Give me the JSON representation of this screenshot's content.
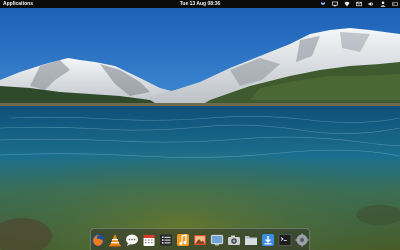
{
  "panel": {
    "applications_label": "Applications",
    "clock": "Tue 13 Aug 08:36"
  },
  "indicators": [
    {
      "icon": "dropbox-icon"
    },
    {
      "icon": "display-icon"
    },
    {
      "icon": "wifi-icon"
    },
    {
      "icon": "mail-icon"
    },
    {
      "icon": "volume-icon"
    },
    {
      "icon": "user-icon"
    },
    {
      "icon": "power-icon"
    }
  ],
  "dock": [
    {
      "icon": "firefox-icon"
    },
    {
      "icon": "vlc-icon"
    },
    {
      "icon": "chat-icon"
    },
    {
      "icon": "calendar-icon"
    },
    {
      "icon": "task-list-icon"
    },
    {
      "icon": "music-icon"
    },
    {
      "icon": "photos-icon"
    },
    {
      "icon": "screenshot-icon"
    },
    {
      "icon": "camera-icon"
    },
    {
      "icon": "files-icon"
    },
    {
      "icon": "downloads-icon"
    },
    {
      "icon": "terminal-icon"
    },
    {
      "icon": "settings-icon"
    }
  ],
  "colors": {
    "panel": "#0b0b0b",
    "sky_top": "#1e63b8",
    "sky_bottom": "#8ec6ee",
    "lake_deep": "#0f3f66",
    "lake_shallow": "#4f6f2a"
  }
}
